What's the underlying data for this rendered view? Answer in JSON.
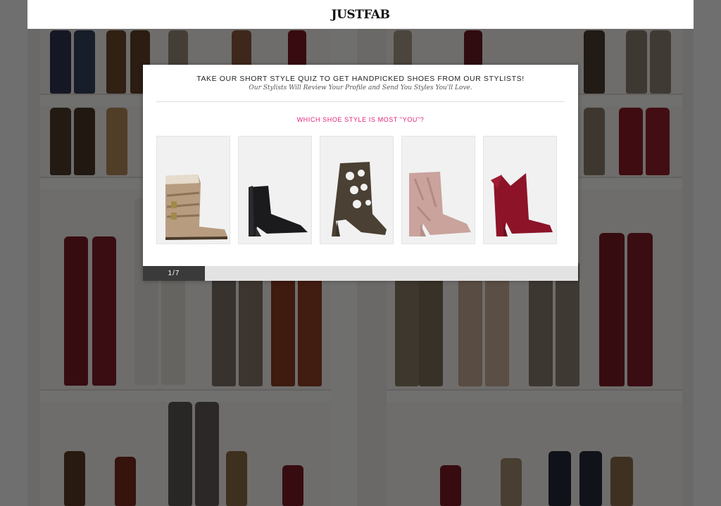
{
  "header": {
    "logo": "JUSTFAB"
  },
  "quiz": {
    "title": "TAKE OUR SHORT STYLE QUIZ TO GET HANDPICKED SHOES FROM OUR STYLISTS!",
    "subtitle": "Our Stylists Will Review Your Profile and Send You Styles You'll Love.",
    "question": "WHICH SHOE STYLE IS MOST \"YOU\"?",
    "options": [
      {
        "icon": "slouch-buckle-boot-icon",
        "color": "#b89c80"
      },
      {
        "icon": "black-suede-bootie-icon",
        "color": "#1b1b1d"
      },
      {
        "icon": "cutout-heel-bootie-icon",
        "color": "#4a4033"
      },
      {
        "icon": "velvet-block-heel-bootie-icon",
        "color": "#c9a39c"
      },
      {
        "icon": "red-bow-bootie-icon",
        "color": "#8d1428"
      }
    ],
    "progress": {
      "label": "1/7",
      "fraction": 0.1428
    }
  },
  "colors": {
    "accent": "#e0217a",
    "progress_fill": "#3a3a3a"
  }
}
